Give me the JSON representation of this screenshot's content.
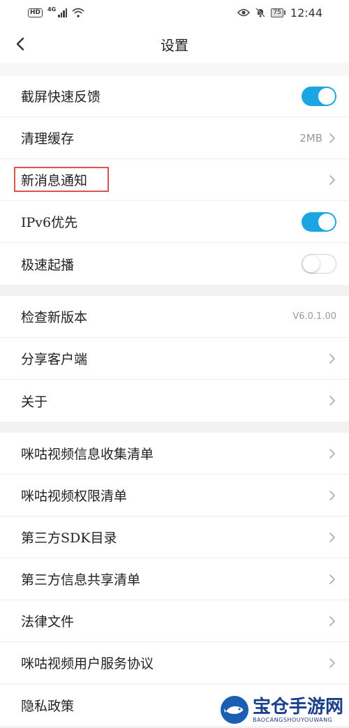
{
  "statusbar": {
    "hd": "HD",
    "network": "4G",
    "battery": "75",
    "time": "12:44"
  },
  "header": {
    "title": "设置"
  },
  "groups": [
    {
      "items": [
        {
          "label": "截屏快速反馈",
          "type": "toggle",
          "state": "on"
        },
        {
          "label": "清理缓存",
          "type": "value",
          "value": "2MB"
        },
        {
          "label": "新消息通知",
          "type": "link",
          "highlighted": true
        },
        {
          "label": "IPv6优先",
          "type": "toggle",
          "state": "on"
        },
        {
          "label": "极速起播",
          "type": "toggle",
          "state": "off"
        }
      ]
    },
    {
      "items": [
        {
          "label": "检查新版本",
          "type": "value",
          "value": "V6.0.1.00"
        },
        {
          "label": "分享客户端",
          "type": "link"
        },
        {
          "label": "关于",
          "type": "link"
        }
      ]
    },
    {
      "items": [
        {
          "label": "咪咕视频信息收集清单",
          "type": "link"
        },
        {
          "label": "咪咕视频权限清单",
          "type": "link"
        },
        {
          "label": "第三方SDK目录",
          "type": "link"
        },
        {
          "label": "第三方信息共享清单",
          "type": "link"
        },
        {
          "label": "法律文件",
          "type": "link"
        },
        {
          "label": "咪咕视频用户服务协议",
          "type": "link"
        },
        {
          "label": "隐私政策",
          "type": "link"
        }
      ]
    }
  ],
  "watermark": {
    "main": "宝仓手游网",
    "sub": "BAOCANGSHOUYOUWANG"
  },
  "colors": {
    "toggle_on": "#1ba6e3",
    "highlight": "#d9534f"
  }
}
